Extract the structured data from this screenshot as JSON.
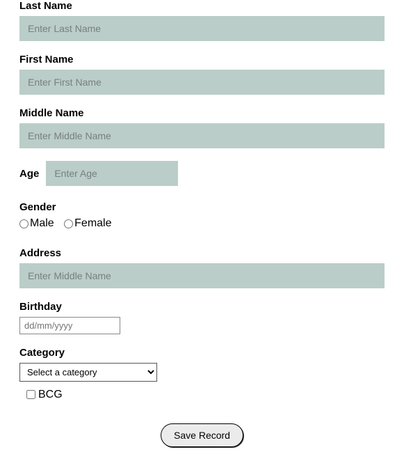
{
  "lastName": {
    "label": "Last Name",
    "placeholder": "Enter Last Name"
  },
  "firstName": {
    "label": "First Name",
    "placeholder": "Enter First Name"
  },
  "middleName": {
    "label": "Middle Name",
    "placeholder": "Enter Middle Name"
  },
  "age": {
    "label": "Age",
    "placeholder": "Enter Age"
  },
  "gender": {
    "label": "Gender",
    "options": {
      "male": "Male",
      "female": "Female"
    }
  },
  "address": {
    "label": "Address",
    "placeholder": "Enter Middle Name"
  },
  "birthday": {
    "label": "Birthday",
    "placeholder": "dd/mm/yyyy"
  },
  "category": {
    "label": "Category",
    "placeholder": "Select a category"
  },
  "bcg": {
    "label": "BCG"
  },
  "saveButton": "Save Record"
}
